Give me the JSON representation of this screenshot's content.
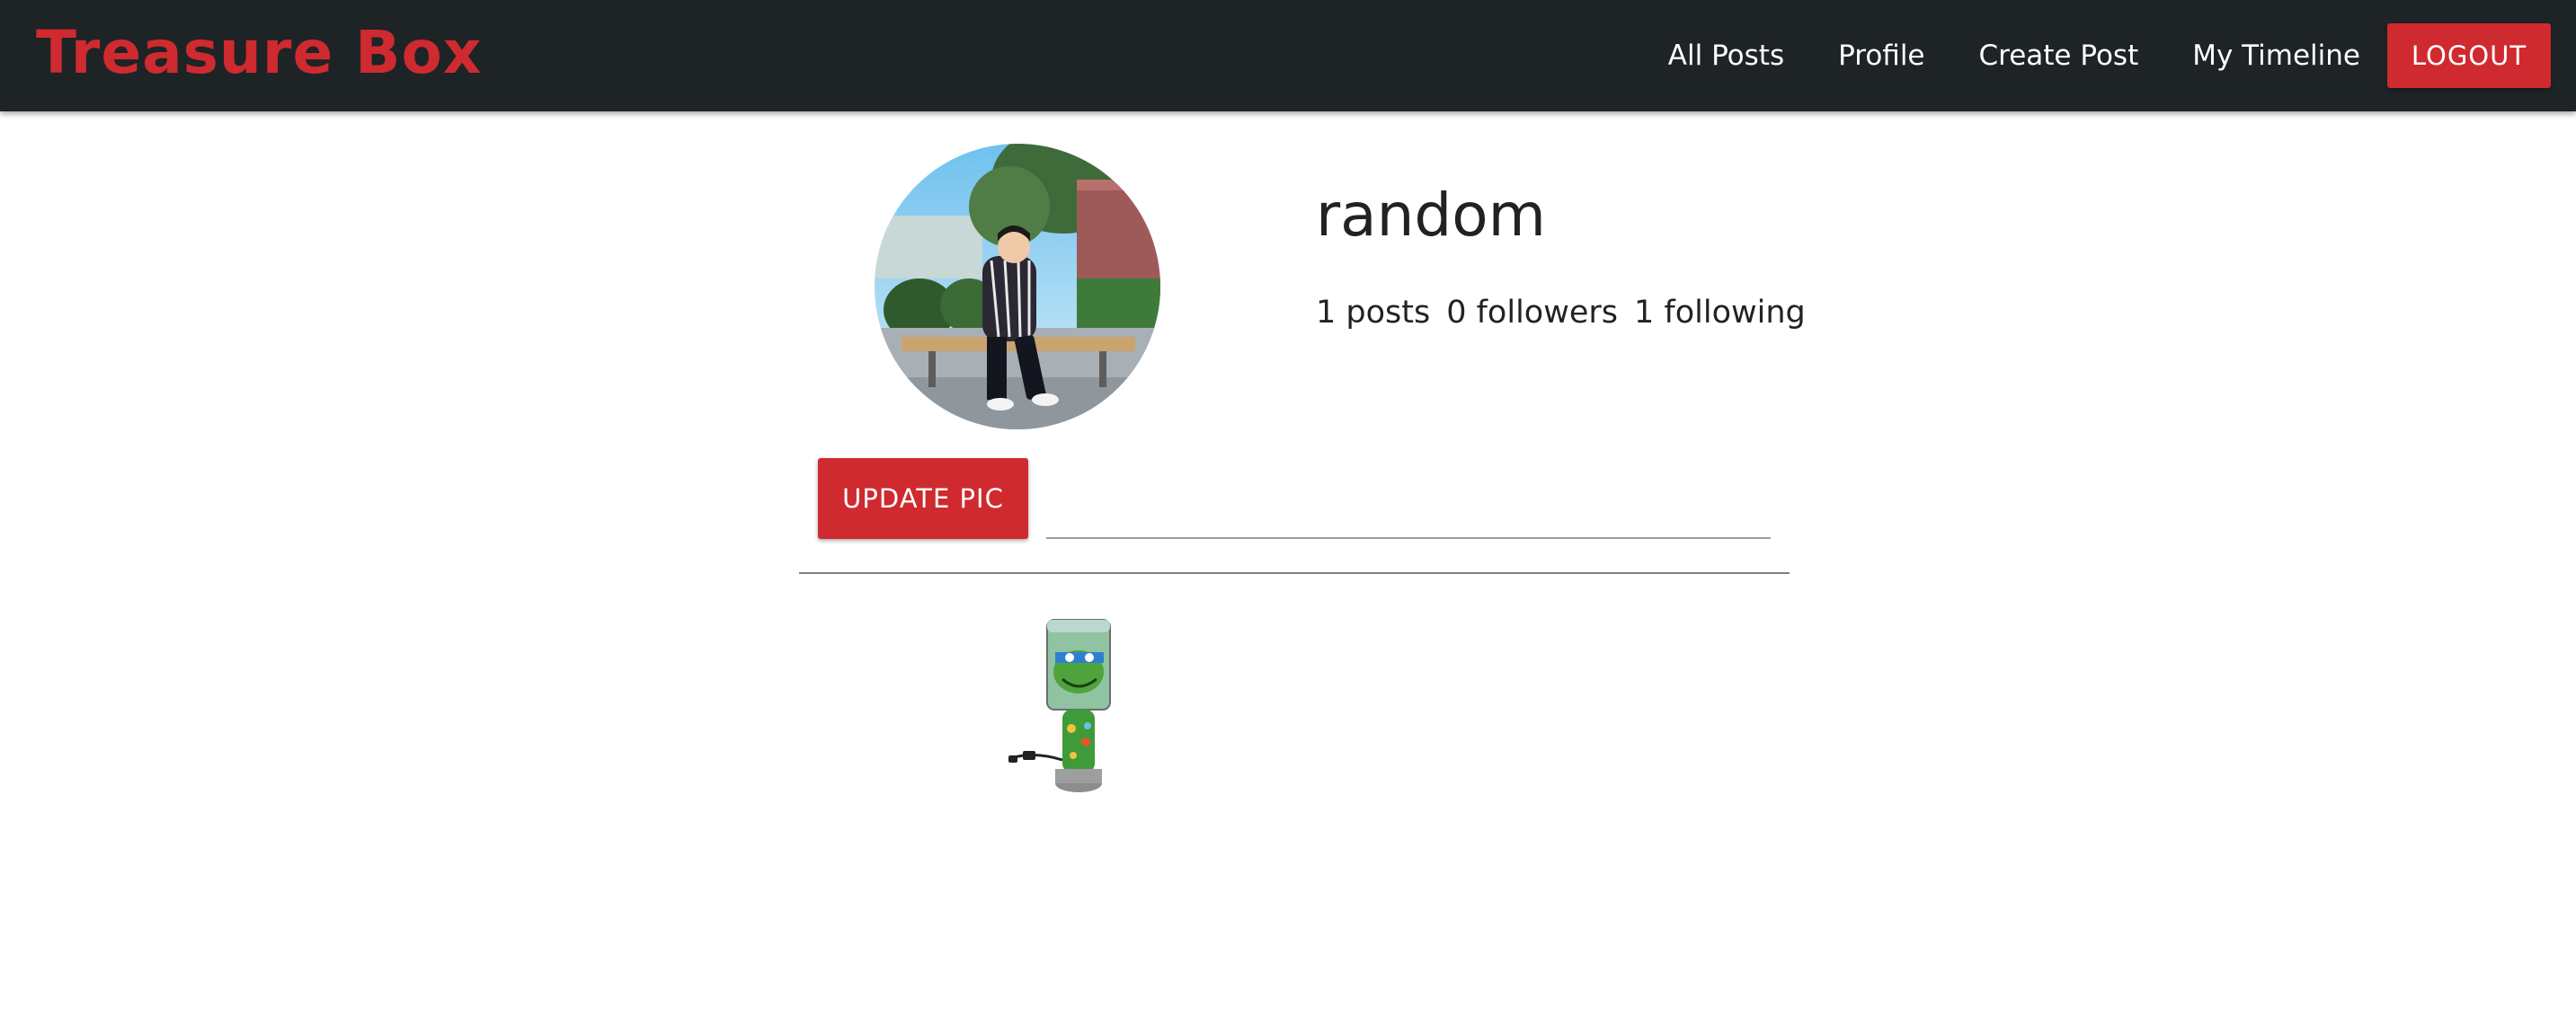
{
  "navbar": {
    "brand": "Treasure Box",
    "links": [
      "All Posts",
      "Profile",
      "Create Post",
      "My Timeline"
    ],
    "logout_label": "LOGOUT"
  },
  "profile": {
    "username": "random",
    "stats": {
      "posts": "1 posts",
      "followers": "0 followers",
      "following": "1 following"
    },
    "update_pic_label": "UPDATE PIC",
    "file_path_placeholder": ""
  },
  "gallery": {
    "items": [
      {
        "icon": "turtle-lamp-photo"
      }
    ]
  },
  "colors": {
    "navbar_bg": "#1e2326",
    "accent": "#cf2a2f"
  }
}
